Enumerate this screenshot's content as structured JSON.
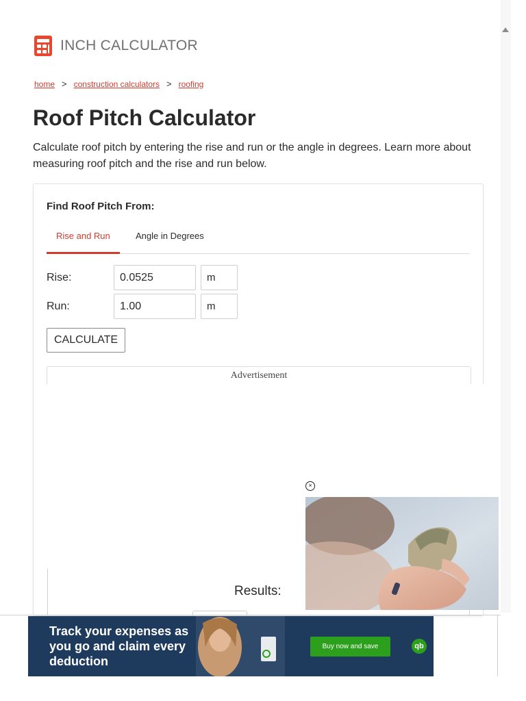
{
  "brand": {
    "name": "INCH CALCULATOR",
    "accent": "#e8462e"
  },
  "breadcrumb": {
    "items": [
      "home",
      "construction calculators",
      "roofing"
    ],
    "separator": ">"
  },
  "page": {
    "title": "Roof Pitch Calculator",
    "intro": "Calculate roof pitch by entering the rise and run or the angle in degrees. Learn more about measuring roof pitch and the rise and run below."
  },
  "calculator": {
    "find_label": "Find Roof Pitch From:",
    "tabs": [
      {
        "label": "Rise and Run",
        "active": true
      },
      {
        "label": "Angle in Degrees",
        "active": false
      }
    ],
    "rise": {
      "label": "Rise:",
      "value": "0.0525",
      "unit": "m"
    },
    "run": {
      "label": "Run:",
      "value": "1.00",
      "unit": "m"
    },
    "calculate_label": "CALCULATE",
    "advertisement_label": "Advertisement",
    "results_label": "Results:"
  },
  "video_ad": {
    "close_icon": "close-circle-icon"
  },
  "bottom_ad": {
    "text": "Track your expenses as you go and claim every deduction",
    "button_label": "Buy now and save",
    "brand_icon": "qb"
  }
}
